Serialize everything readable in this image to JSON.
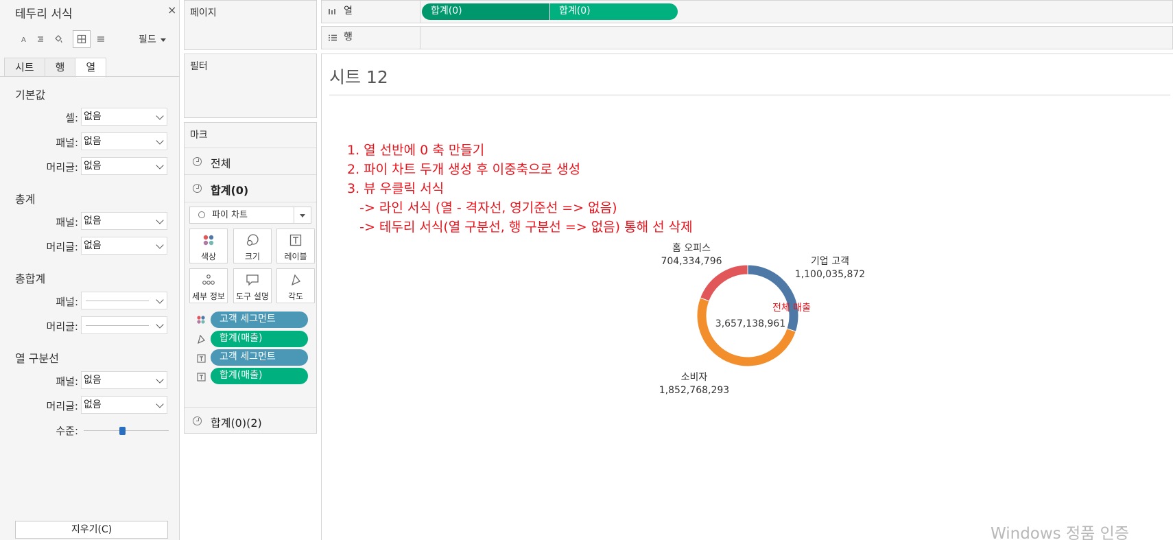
{
  "format_pane": {
    "title": "테두리 서식",
    "close": "×",
    "field_label": "필드",
    "tabs": [
      "시트",
      "행",
      "열"
    ],
    "sections": {
      "default": {
        "title": "기본값",
        "cell_label": "셀:",
        "cell_value": "없음",
        "pane_label": "패널:",
        "pane_value": "없음",
        "header_label": "머리글:",
        "header_value": "없음"
      },
      "total": {
        "title": "총계",
        "pane_label": "패널:",
        "pane_value": "없음",
        "header_label": "머리글:",
        "header_value": "없음"
      },
      "grand_total": {
        "title": "총합계",
        "pane_label": "패널:",
        "header_label": "머리글:"
      },
      "column_divider": {
        "title": "열 구분선",
        "pane_label": "패널:",
        "pane_value": "없음",
        "header_label": "머리글:",
        "header_value": "없음",
        "level_label": "수준:",
        "level_fraction": 0.45
      }
    },
    "clear_button": "지우기(C)"
  },
  "pages_card": {
    "title": "페이지"
  },
  "filters_card": {
    "title": "필터"
  },
  "marks": {
    "title": "마크",
    "all_label": "전체",
    "layer1_label": "합계(0)",
    "mark_type": "파이 차트",
    "buttons": [
      "색상",
      "크기",
      "레이블",
      "세부 정보",
      "도구 설명",
      "각도"
    ],
    "pills": [
      {
        "icon": "color-icon",
        "label": "고객 세그먼트",
        "kind": "dimension"
      },
      {
        "icon": "angle-icon",
        "label": "합계(매출)",
        "kind": "measure"
      },
      {
        "icon": "label-icon",
        "label": "고객 세그먼트",
        "kind": "dimension"
      },
      {
        "icon": "label-icon",
        "label": "합계(매출)",
        "kind": "measure"
      }
    ],
    "layer2_label": "합계(0)(2)"
  },
  "shelves": {
    "columns_label": "열",
    "rows_label": "행",
    "column_pills": [
      "합계(0)",
      "합계(0)"
    ]
  },
  "view": {
    "sheet_title": "시트 12",
    "notes": [
      "1. 열 선반에 0 축 만들기",
      "2. 파이 차트 두개 생성 후 이중축으로 생성",
      "3. 뷰 우클릭 서식",
      "   -> 라인 서식 (열 - 격자선, 영기준선 => 없음)",
      "   -> 테두리 서식(열 구분선, 행 구분선 => 없음) 통해 선 삭제"
    ],
    "center_label": "전체 매출",
    "center_value": "3,657,138,961"
  },
  "chart_data": {
    "type": "pie",
    "variant": "donut",
    "categories": [
      "기업 고객",
      "소비자",
      "홈 오피스"
    ],
    "values": [
      1100035872,
      1852768293,
      704334796
    ],
    "value_labels": [
      "1,100,035,872",
      "1,852,768,293",
      "704,334,796"
    ],
    "colors": [
      "#4e79a7",
      "#f28e2b",
      "#e15759"
    ],
    "center_text": "전체 매출",
    "center_total": "3,657,138,961"
  },
  "watermark": "Windows 정품 인증",
  "colors": {
    "measure_pill": "#00b07f",
    "dimension_pill": "#4a98b6",
    "annotation": "#e8141c"
  }
}
